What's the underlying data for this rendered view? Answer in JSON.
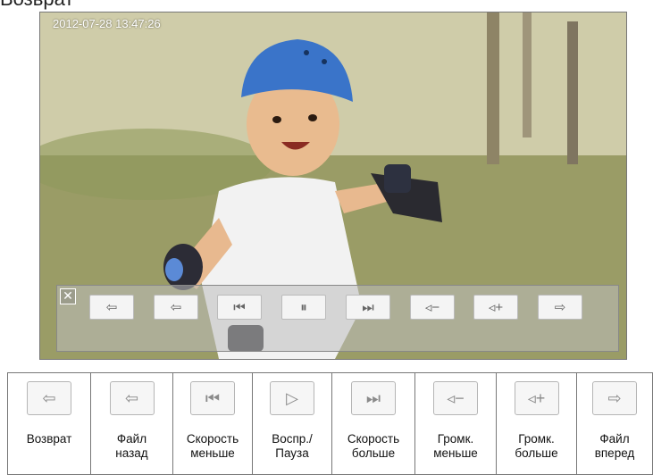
{
  "caption": "Возврат",
  "screen": {
    "timestamp": "2012-07-28 13:47:26"
  },
  "overlay": {
    "close_icon": "✕",
    "buttons": [
      {
        "icon": "return-icon",
        "glyph": "⇦"
      },
      {
        "icon": "prev-file-icon",
        "glyph": "⇦"
      },
      {
        "icon": "slower-icon",
        "glyph": "⏮"
      },
      {
        "icon": "pause-icon",
        "glyph": "⏸"
      },
      {
        "icon": "faster-icon",
        "glyph": "⏭"
      },
      {
        "icon": "volume-down-icon",
        "glyph": "◃−"
      },
      {
        "icon": "volume-up-icon",
        "glyph": "◃+"
      },
      {
        "icon": "next-file-icon",
        "glyph": "⇨"
      }
    ]
  },
  "legend": {
    "items": [
      {
        "label": "Возврат",
        "icon": "return-icon",
        "glyph": "⇦"
      },
      {
        "label": "Файл\nназад",
        "icon": "prev-file-icon",
        "glyph": "⇦"
      },
      {
        "label": "Скорость\nменьше",
        "icon": "slower-icon",
        "glyph": "⏮"
      },
      {
        "label": "Воспр./\nПауза",
        "icon": "play-icon",
        "glyph": "▷"
      },
      {
        "label": "Скорость\nбольше",
        "icon": "faster-icon",
        "glyph": "⏭"
      },
      {
        "label": "Громк.\nменьше",
        "icon": "volume-down-icon",
        "glyph": "◃−"
      },
      {
        "label": "Громк.\nбольше",
        "icon": "volume-up-icon",
        "glyph": "◃+"
      },
      {
        "label": "Файл\nвперед",
        "icon": "next-file-icon",
        "glyph": "⇨"
      }
    ]
  }
}
